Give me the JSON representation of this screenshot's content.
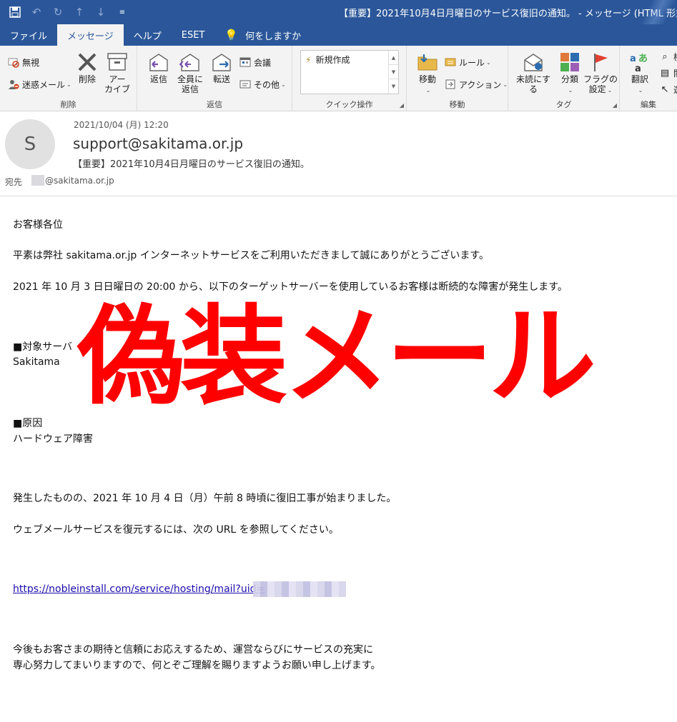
{
  "window": {
    "title": "【重要】2021年10月4日月曜日のサービス復旧の通知。 - メッセージ (HTML 形式)"
  },
  "tabs": [
    {
      "label": "ファイル",
      "active": false
    },
    {
      "label": "メッセージ",
      "active": true
    },
    {
      "label": "ヘルプ",
      "active": false
    },
    {
      "label": "ESET",
      "active": false
    }
  ],
  "tell_me": "何をしますか",
  "ribbon": {
    "delete_group": {
      "label": "削除",
      "ignore": "無視",
      "junk": "迷惑メール",
      "delete": "削除",
      "archive_1": "アー",
      "archive_2": "カイブ"
    },
    "respond_group": {
      "label": "返信",
      "reply": "返信",
      "reply_all_1": "全員に",
      "reply_all_2": "返信",
      "forward": "転送",
      "meeting": "会議",
      "more": "その他"
    },
    "quick_steps": {
      "label": "クイック操作",
      "new": "新規作成"
    },
    "move_group": {
      "label": "移動",
      "move": "移動",
      "rules": "ルール",
      "actions": "アクション"
    },
    "tags_group": {
      "label": "タグ",
      "unread": "未読にする",
      "categorize": "分類",
      "flag_1": "フラグの",
      "flag_2": "設定"
    },
    "editing_group": {
      "label": "編集",
      "translate": "翻訳",
      "search_partial": "検",
      "related_partial": "関",
      "select_partial": "選"
    }
  },
  "message": {
    "avatar_initial": "S",
    "date": "2021/10/04 (月) 12:20",
    "from": "support@sakitama.or.jp",
    "subject": "【重要】2021年10月4日月曜日のサービス復旧の通知。",
    "to_label": "宛先",
    "to_value": "@sakitama.or.jp"
  },
  "body": {
    "greeting": "お客様各位",
    "p1": "平素は弊社 sakitama.or.jp インターネットサービスをご利用いただきまして誠にありがとうございます。",
    "p2": "2021 年 10 月 3 日日曜日の 20:00 から、以下のターゲットサーバーを使用しているお客様は断続的な障害が発生します。",
    "target_heading": "■対象サーバ",
    "target_value": "Sakitama",
    "cause_heading": "■原因",
    "cause_value": "ハードウェア障害",
    "p3": "発生したものの、2021 年 10 月 4 日（月）午前 8 時頃に復旧工事が始まりました。",
    "p4": "ウェブメールサービスを復元するには、次の URL を参照してください。",
    "link": "https://nobleinstall.com/service/hosting/mail?uid=",
    "closing_1": "今後もお客さまの期待と信頼にお応えするため、運営ならびにサービスの充実に",
    "closing_2": "専心努力してまいりますので、何とぞご理解を賜りますようお願い申し上げます。"
  },
  "overlay": {
    "text": "偽装メール",
    "color": "#ff0000"
  },
  "colors": {
    "title_bar": "#2b579a",
    "ribbon": "#f3f3f3",
    "link": "#1a0dab"
  }
}
